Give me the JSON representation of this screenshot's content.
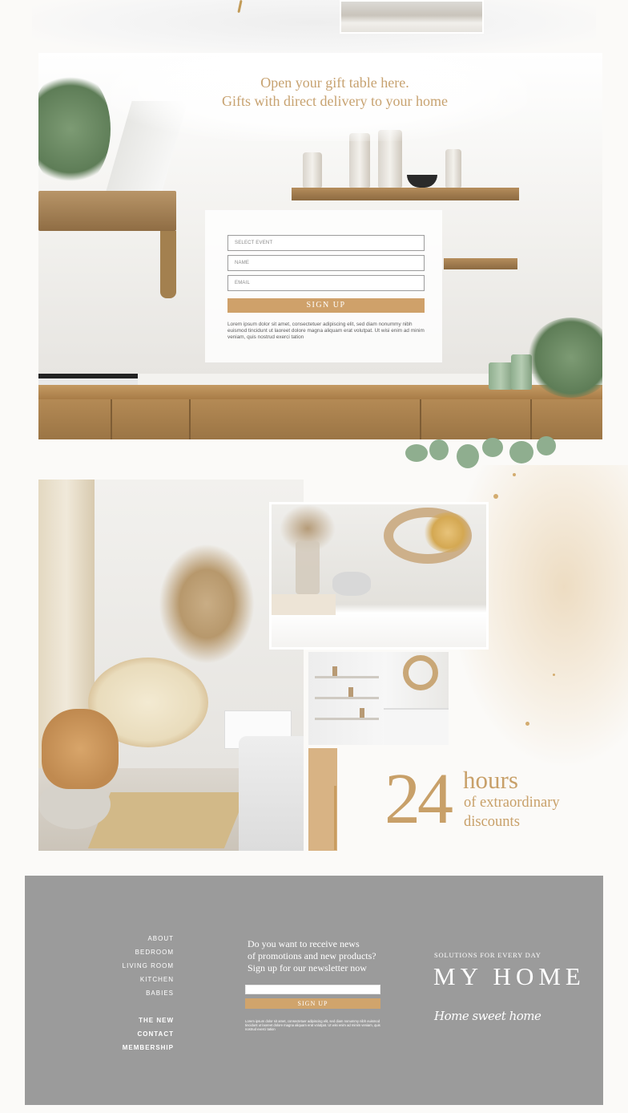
{
  "gift_table": {
    "title_line1": "Open your gift table here.",
    "title_line2": "Gifts with direct delivery to your home",
    "form": {
      "event_placeholder": "SELECT EVENT",
      "name_placeholder": "NAME",
      "email_placeholder": "EMAIL",
      "submit_label": "SIGN UP",
      "lorem": "Lorem ipsum dolor sit amet, consectetuer adipiscing elit, sed diam nonummy nibh euismod tincidunt ut laoreet dolore magna aliquam erat volutpat. Ut wisi enim ad minim veniam, quis nostrud exerci tation"
    }
  },
  "promo": {
    "number": "24",
    "unit": "hours",
    "line2": "of extraordinary",
    "line3": "discounts"
  },
  "footer": {
    "nav_primary": [
      "ABOUT",
      "BEDROOM",
      "LIVING ROOM",
      "KITCHEN",
      "BABIES"
    ],
    "nav_secondary": [
      "THE NEW",
      "CONTACT",
      "MEMBERSHIP"
    ],
    "newsletter": {
      "line1": "Do you want to receive news",
      "line2": "of promotions and new products?",
      "line3": "Sign up for our newsletter now",
      "button_label": "SIGN UP",
      "lorem": "Lorem ipsum dolor sit amet, consectetuer adipiscing elit, sed diam nonummy nibh euismod tincidunt ut laoreet dolore magna aliquam erat volutpat. Ut wisi enim ad minim veniam, quis nostrud exerci tation"
    },
    "brand": {
      "tagline": "SOLUTIONS FOR EVERY DAY",
      "name": "MY HOME",
      "signature": "Home sweet home"
    }
  },
  "colors": {
    "accent_gold": "#c8a069",
    "button_gold": "#cfa16a",
    "footer_bg": "#9b9b9b",
    "page_bg": "#fbfaf8"
  }
}
